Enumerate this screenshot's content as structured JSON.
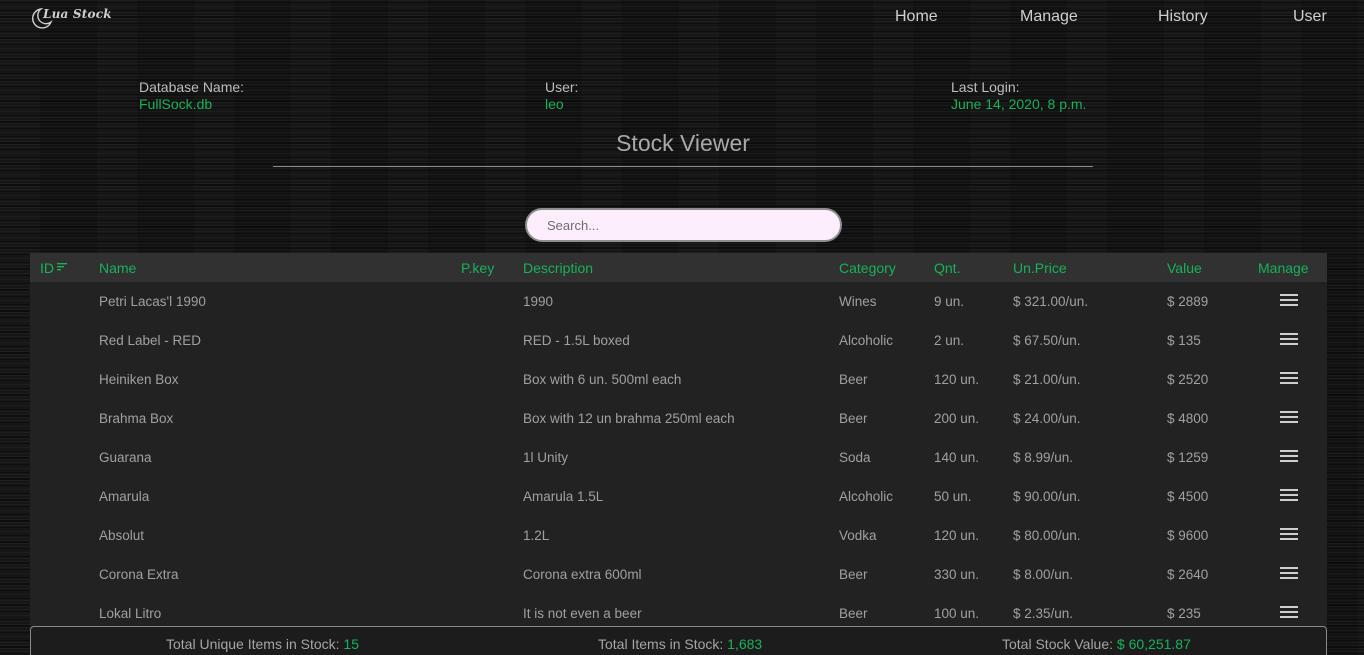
{
  "app": {
    "logo_text": "Lua Stock"
  },
  "nav": {
    "home": "Home",
    "manage": "Manage",
    "history": "History",
    "user": "User"
  },
  "info": {
    "db_label": "Database Name:",
    "db_value": "FullSock.db",
    "user_label": "User:",
    "user_value": "leo",
    "login_label": "Last Login:",
    "login_value": "June 14, 2020, 8 p.m."
  },
  "page": {
    "title": "Stock Viewer"
  },
  "search": {
    "placeholder": "Search..."
  },
  "table": {
    "headers": {
      "id": "ID",
      "name": "Name",
      "pkey": "P.key",
      "description": "Description",
      "category": "Category",
      "qnt": "Qnt.",
      "unprice": "Un.Price",
      "value": "Value",
      "manage": "Manage"
    },
    "rows": [
      {
        "id": "",
        "name": "Petri Lacas'l 1990",
        "pkey": "",
        "description": "1990",
        "category": "Wines",
        "qnt": "9 un.",
        "unprice": "$ 321.00/un.",
        "value": "$ 2889"
      },
      {
        "id": "",
        "name": "Red Label - RED",
        "pkey": "",
        "description": "RED - 1.5L boxed",
        "category": "Alcoholic",
        "qnt": "2 un.",
        "unprice": "$ 67.50/un.",
        "value": "$ 135"
      },
      {
        "id": "",
        "name": "Heiniken Box",
        "pkey": "",
        "description": "Box with 6 un. 500ml each",
        "category": "Beer",
        "qnt": "120 un.",
        "unprice": "$ 21.00/un.",
        "value": "$ 2520"
      },
      {
        "id": "",
        "name": "Brahma Box",
        "pkey": "",
        "description": "Box with 12 un brahma 250ml each",
        "category": "Beer",
        "qnt": "200 un.",
        "unprice": "$ 24.00/un.",
        "value": "$ 4800"
      },
      {
        "id": "",
        "name": "Guarana",
        "pkey": "",
        "description": "1l Unity",
        "category": "Soda",
        "qnt": "140 un.",
        "unprice": "$ 8.99/un.",
        "value": "$ 1259"
      },
      {
        "id": "",
        "name": "Amarula",
        "pkey": "",
        "description": "Amarula 1.5L",
        "category": "Alcoholic",
        "qnt": "50 un.",
        "unprice": "$ 90.00/un.",
        "value": "$ 4500"
      },
      {
        "id": "",
        "name": "Absolut",
        "pkey": "",
        "description": "1.2L",
        "category": "Vodka",
        "qnt": "120 un.",
        "unprice": "$ 80.00/un.",
        "value": "$ 9600"
      },
      {
        "id": "",
        "name": "Corona Extra",
        "pkey": "",
        "description": "Corona extra 600ml",
        "category": "Beer",
        "qnt": "330 un.",
        "unprice": "$ 8.00/un.",
        "value": "$ 2640"
      },
      {
        "id": "",
        "name": "Lokal Litro",
        "pkey": "",
        "description": "It is not even a beer",
        "category": "Beer",
        "qnt": "100 un.",
        "unprice": "$ 2.35/un.",
        "value": "$ 235"
      }
    ]
  },
  "totals": {
    "unique_label": "Total Unique Items in Stock:",
    "unique_value": "15",
    "items_label": "Total Items in Stock:",
    "items_value": "1,683",
    "value_label": "Total Stock Value:",
    "value_value": "$ 60,251.87"
  },
  "colors": {
    "accent": "#17b25a",
    "search_bg": "#fdeefe",
    "table_bg": "#222222",
    "header_bg": "#313131"
  },
  "icons": {
    "logo": "crescent-moon-icon",
    "sort": "sort-lines-icon",
    "manage": "list-menu-icon"
  }
}
